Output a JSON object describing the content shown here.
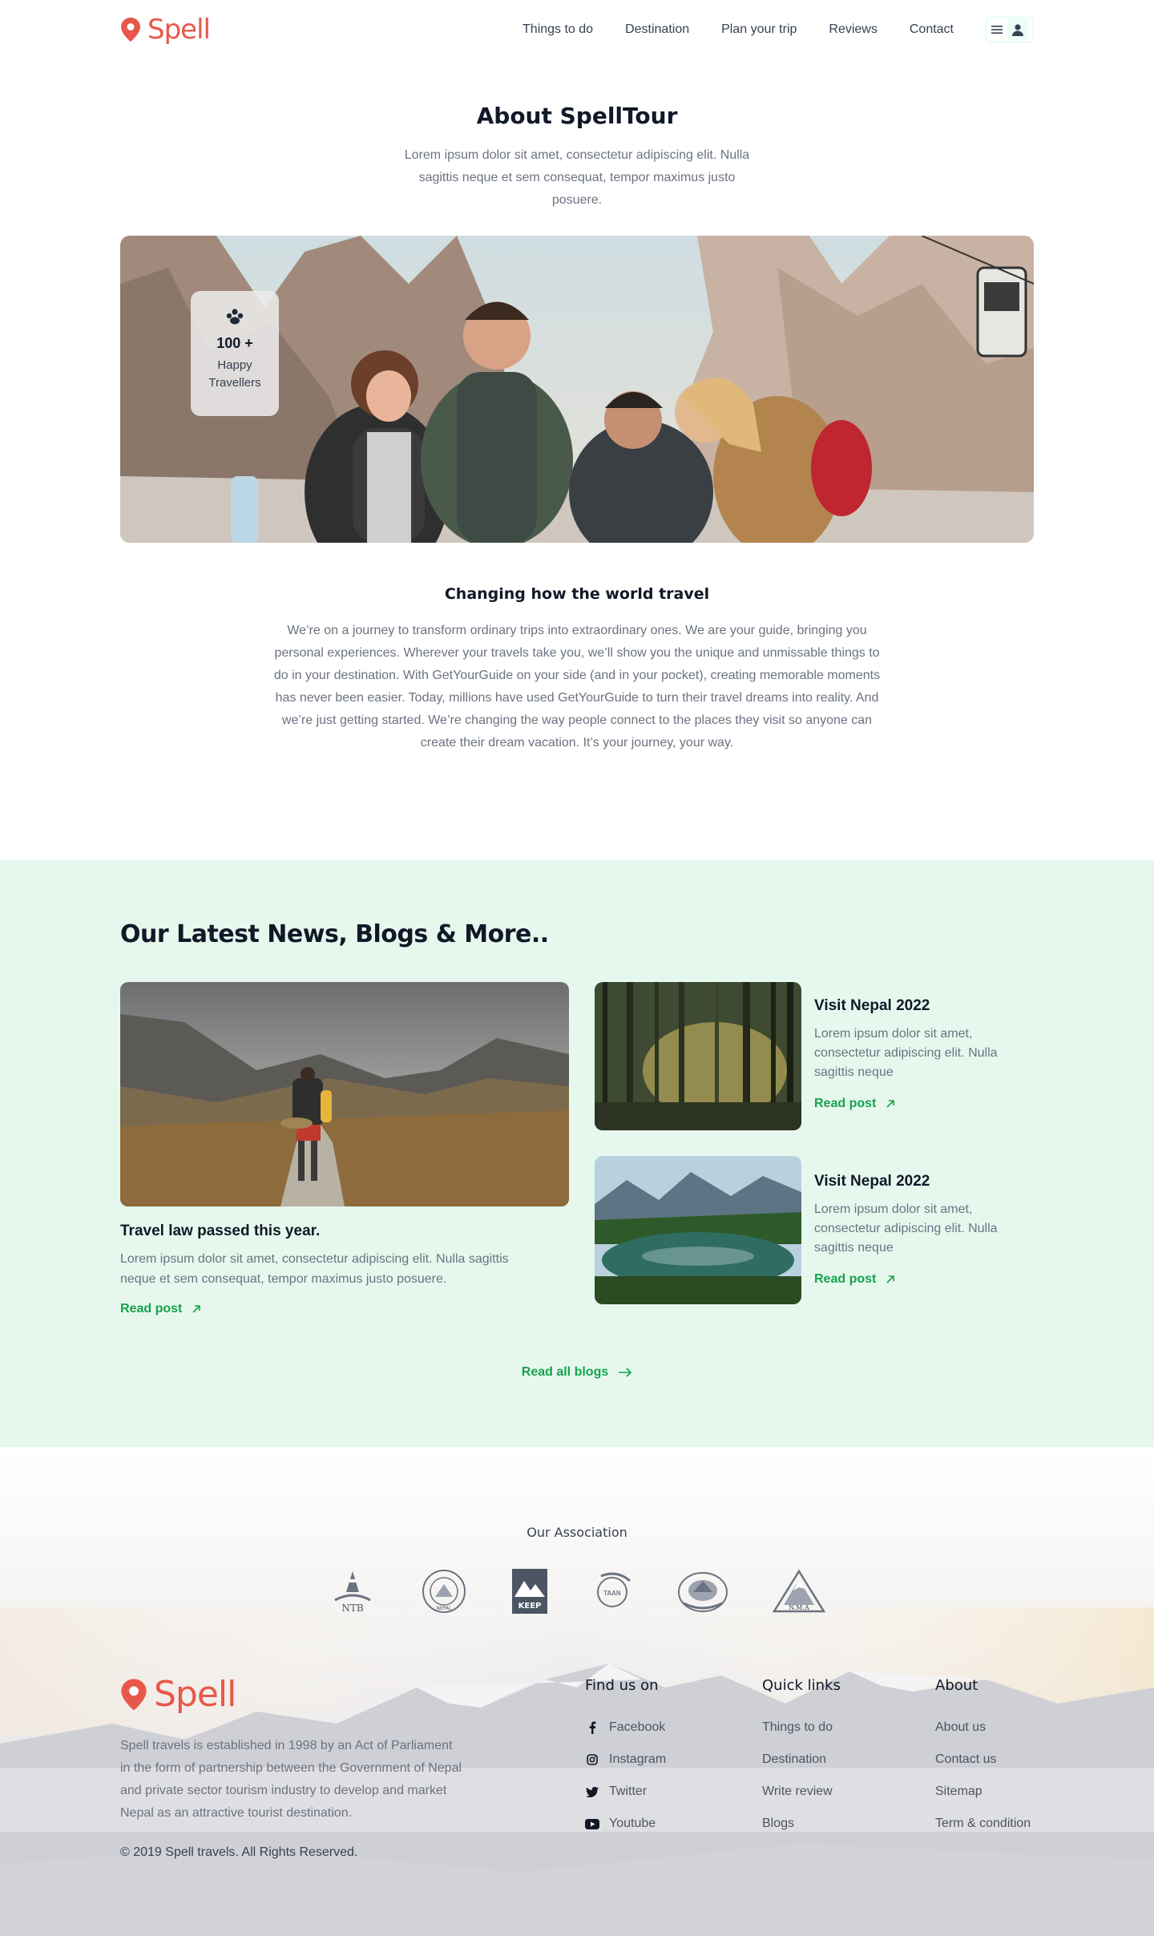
{
  "header": {
    "logo_text": "Spell",
    "nav": [
      "Things to do",
      "Destination",
      "Plan your trip",
      "Reviews",
      "Contact"
    ]
  },
  "about": {
    "title": "About SpellTour",
    "subtitle": "Lorem ipsum dolor sit amet, consectetur adipiscing elit. Nulla sagittis neque et sem consequat, tempor maximus justo posuere.",
    "stat_number": "100 +",
    "stat_label": "Happy Travellers",
    "heading": "Changing how the world travel",
    "body": "We’re on a journey to transform ordinary trips into extraordinary ones. We are your guide, bringing you personal experiences. Wherever your travels take you, we’ll show you the unique and unmissable things to do in your destination. With GetYourGuide on your side (and in your pocket), creating memorable moments has never been easier. Today, millions have used GetYourGuide to turn their travel dreams into reality. And we’re just getting started. We’re changing the way people connect to the places they visit so anyone can create their dream vacation. It’s your journey, your way."
  },
  "news": {
    "title": "Our Latest News, Blogs & More..",
    "featured": {
      "title": "Travel law passed this year.",
      "body": "Lorem ipsum dolor sit amet, consectetur adipiscing elit. Nulla sagittis neque et sem consequat, tempor maximus justo posuere.",
      "read": "Read post"
    },
    "cards": [
      {
        "title": "Visit Nepal 2022",
        "body": "Lorem ipsum dolor sit amet, consectetur adipiscing elit. Nulla sagittis neque",
        "read": "Read post"
      },
      {
        "title": "Visit Nepal 2022",
        "body": "Lorem ipsum dolor sit amet, consectetur adipiscing elit. Nulla sagittis neque",
        "read": "Read post"
      }
    ],
    "read_all": "Read all blogs"
  },
  "association": {
    "title": "Our Association",
    "logos": [
      "NTB",
      "NEPAL",
      "KEEP",
      "TAAN",
      "",
      "N.M.A"
    ]
  },
  "footer": {
    "logo_text": "Spell",
    "description": "Spell travels is established in 1998 by an Act of Parliament in the form of partnership between the Government of Nepal and private sector tourism industry to develop and market Nepal as an attractive tourist destination.",
    "copyright": "© 2019 Spell travels. All Rights Reserved.",
    "find_us": {
      "title": "Find us on",
      "items": [
        {
          "label": "Facebook",
          "icon": "facebook-icon"
        },
        {
          "label": "Instagram",
          "icon": "instagram-icon"
        },
        {
          "label": "Twitter",
          "icon": "twitter-icon"
        },
        {
          "label": "Youtube",
          "icon": "youtube-icon"
        }
      ]
    },
    "quick_links": {
      "title": "Quick links",
      "items": [
        "Things to do",
        "Destination",
        "Write review",
        "Blogs"
      ]
    },
    "about": {
      "title": "About",
      "items": [
        "About us",
        "Contact us",
        "Sitemap",
        "Term & condition"
      ]
    }
  },
  "colors": {
    "brand": "#e8584a",
    "accent_green": "#16a34a",
    "news_bg": "#e6f8ee"
  }
}
